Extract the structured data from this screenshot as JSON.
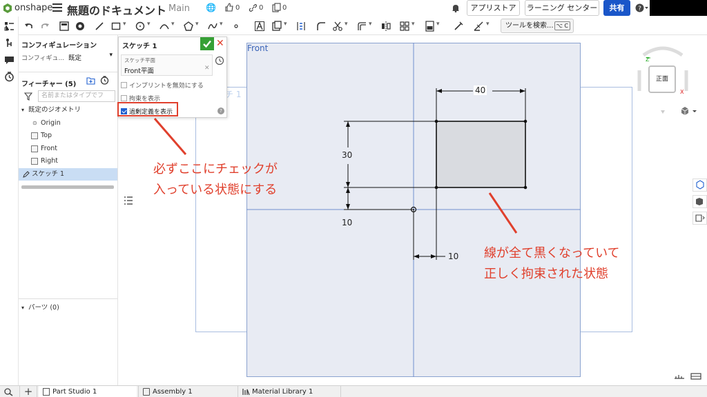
{
  "header": {
    "logo_text": "onshape",
    "doc_title": "無題のドキュメント",
    "branch": "Main",
    "likes": "0",
    "links": "0",
    "copies": "0",
    "app_store_label": "アプリストア",
    "learning_center_label": "ラーニング センター",
    "share_label": "共有"
  },
  "toolbar": {
    "search_tools_label": "ツールを検索...",
    "search_shortcut": "⌥ C"
  },
  "panel": {
    "config_title": "コンフィギュレーション",
    "config_label": "コンフィギュ...",
    "config_value": "既定",
    "features_title": "フィーチャー (5)",
    "filter_placeholder": "名前またはタイプでフ",
    "default_geometry": "既定のジオメトリ",
    "items": [
      {
        "label": "Origin"
      },
      {
        "label": "Top"
      },
      {
        "label": "Front"
      },
      {
        "label": "Right"
      }
    ],
    "sketch_item": "スケッチ 1",
    "parts_title": "パーツ (0)"
  },
  "dialog": {
    "title": "スケッチ 1",
    "plane_label": "スケッチ平面",
    "plane_value": "Front平面",
    "opt_imprint": "インプリントを無効にする",
    "opt_constraints": "拘束を表示",
    "opt_overdefined": "過剰定義を表示"
  },
  "viewport": {
    "plane_label": "Front",
    "sketch_ghost": "スケッチ 1",
    "dim_width": "40",
    "dim_height": "30",
    "dim_vertical_offset": "10",
    "dim_horizontal_offset": "10",
    "annotation_left_line1": "必ずここにチェックが",
    "annotation_left_line2": "入っている状態にする",
    "annotation_right_line1": "線が全て黒くなっていて",
    "annotation_right_line2": "正しく拘束された状態",
    "view_cube_face": "正面",
    "axis_z": "Z",
    "axis_x": "X"
  },
  "tabs": [
    {
      "label": "Part Studio 1"
    },
    {
      "label": "Assembly 1"
    },
    {
      "label": "Material Library 1"
    }
  ],
  "colors": {
    "annotation_red": "#e0402d",
    "accent_blue": "#1a56c9",
    "plane_blue": "#3a64b8",
    "confirm_green": "#36a035"
  }
}
